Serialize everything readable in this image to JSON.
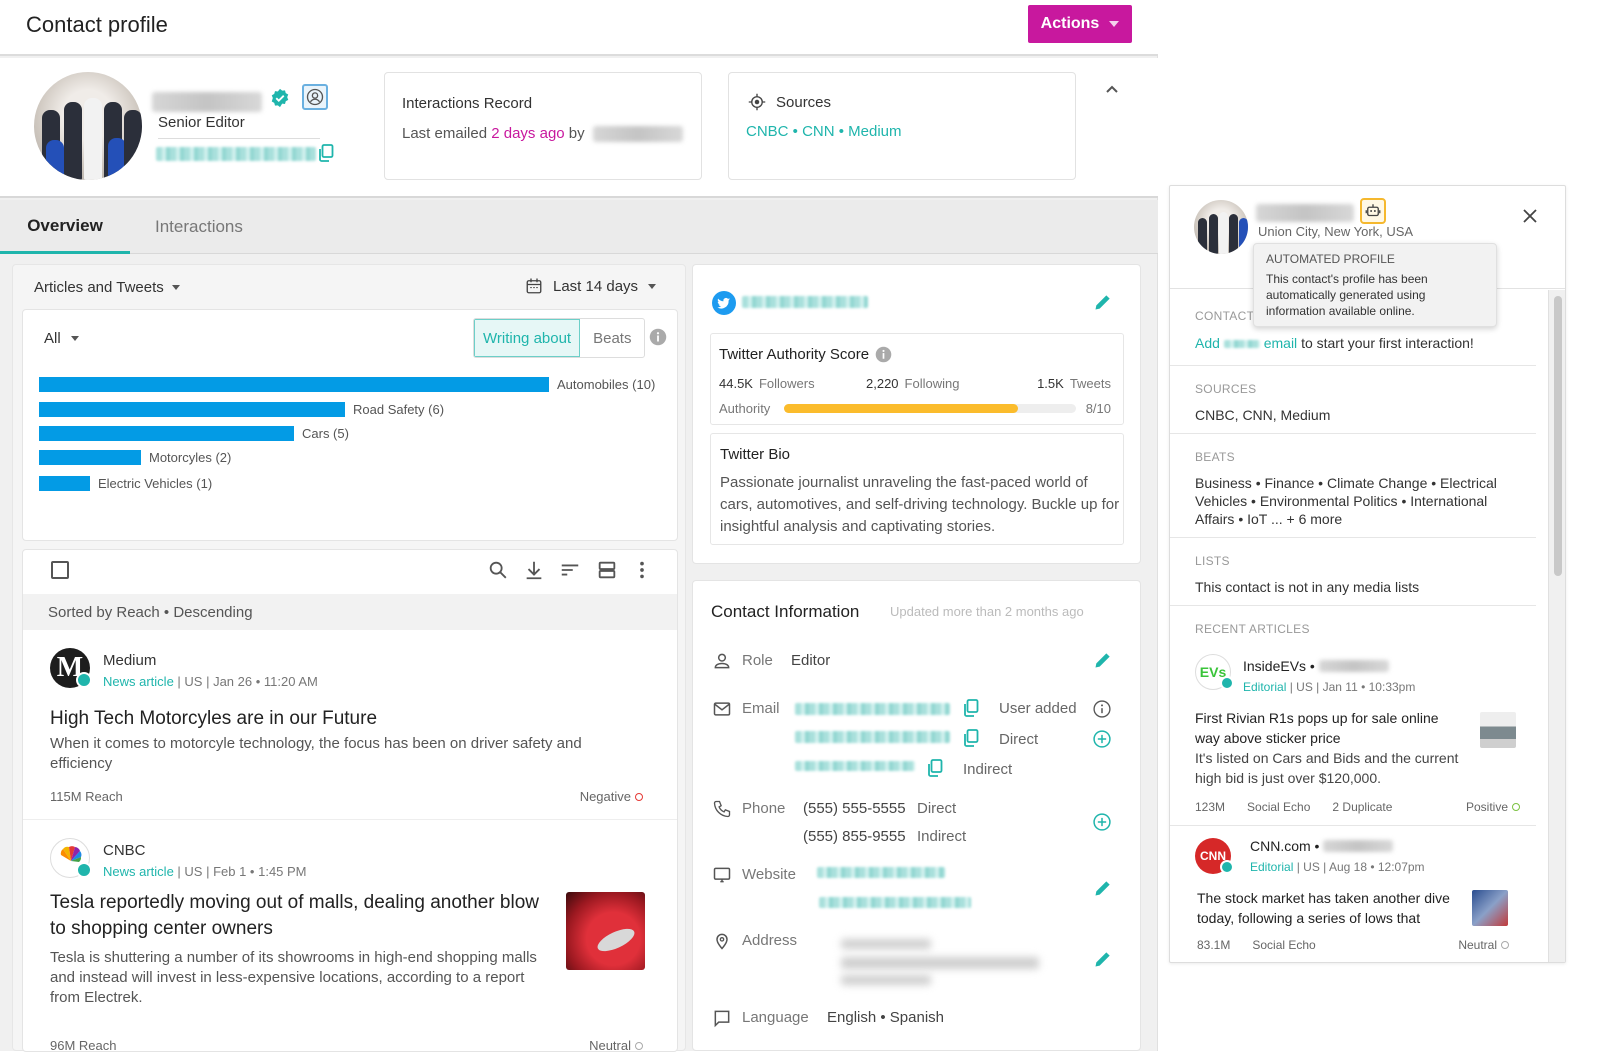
{
  "header": {
    "title": "Contact profile",
    "actions_label": "Actions"
  },
  "profile": {
    "title": "Senior Editor",
    "accent_color": "#1fb5ac",
    "brand_color": "#c8189e"
  },
  "interactions_record": {
    "title": "Interactions Record",
    "prefix": "Last emailed",
    "when": "2 days ago",
    "by": "by"
  },
  "sources_card": {
    "title": "Sources",
    "links": "CNBC • CNN • Medium"
  },
  "tabs": [
    {
      "label": "Overview",
      "active": true
    },
    {
      "label": "Interactions",
      "active": false
    }
  ],
  "articles_panel": {
    "filter_label": "Articles and Tweets",
    "date_range": "Last 14 days",
    "type_filter": "All",
    "toggle": {
      "writing_about": "Writing about",
      "beats": "Beats",
      "selected": "Writing about"
    },
    "sort_label": "Sorted by Reach • Descending"
  },
  "chart_data": {
    "type": "bar",
    "orientation": "horizontal",
    "title": "Writing about",
    "categories": [
      "Automobiles",
      "Road Safety",
      "Cars",
      "Motorcyles",
      "Electric Vehicles"
    ],
    "values": [
      10,
      6,
      5,
      2,
      1
    ],
    "labels": [
      "Automobiles (10)",
      "Road Safety (6)",
      "Cars (5)",
      "Motorcyles (2)",
      "Electric Vehicles (1)"
    ],
    "xlabel": "",
    "ylabel": "",
    "xlim": [
      0,
      10
    ],
    "grid": false,
    "color": "#039be5"
  },
  "articles": [
    {
      "source": "Medium",
      "type": "News article",
      "country": "US",
      "date": "Jan 26 • 11:20 AM",
      "title": "High Tech Motorcyles are in our Future",
      "body": "When it comes to motorcyle technology, the focus has been on driver safety and efficiency",
      "reach": "115M Reach",
      "sentiment": "Negative",
      "sentiment_color": "#e53935"
    },
    {
      "source": "CNBC",
      "type": "News article",
      "country": "US",
      "date": "Feb 1 • 1:45 PM",
      "title": "Tesla reportedly moving out of malls, dealing another blow to shopping center owners",
      "body": "Tesla is shuttering a number of its showrooms in high-end shopping malls and instead will invest in less-expensive locations, according to a report from Electrek.",
      "reach": "96M Reach",
      "sentiment": "Neutral",
      "sentiment_color": "#aaaaaa"
    }
  ],
  "twitter": {
    "handle_prefix": "@",
    "authority_title": "Twitter Authority Score",
    "followers_value": "44.5K",
    "followers_label": "Followers",
    "following_value": "2,220",
    "following_label": "Following",
    "tweets_value": "1.5K",
    "tweets_label": "Tweets",
    "authority_label": "Authority",
    "authority_score": 8,
    "authority_max": 10,
    "authority_text": "8/10",
    "bio_title": "Twitter Bio",
    "bio": "Passionate journalist unraveling the fast-paced world of cars, automotives, and self-driving technology. Buckle up for insightful analysis and captivating stories."
  },
  "contact_info": {
    "title": "Contact Information",
    "updated": "Updated more than 2 months ago",
    "role_label": "Role",
    "role_value": "Editor",
    "email_label": "Email",
    "emails": [
      {
        "tag": "User added"
      },
      {
        "tag": "Direct"
      },
      {
        "tag": "Indirect"
      }
    ],
    "phone_label": "Phone",
    "phones": [
      {
        "number": "(555) 555-5555",
        "tag": "Direct"
      },
      {
        "number": "(555) 855-9555",
        "tag": "Indirect"
      }
    ],
    "website_label": "Website",
    "address_label": "Address",
    "language_label": "Language",
    "language_value": "English • Spanish"
  },
  "side_panel": {
    "location": "Union City, New York, USA",
    "tooltip": {
      "title": "AUTOMATED PROFILE",
      "body": "This contact's profile has been automatically generated using information available online."
    },
    "contact_label": "CONTACT",
    "contact_add": "Add",
    "contact_email": "email",
    "contact_rest": "to start your first interaction!",
    "sources_label": "SOURCES",
    "sources_value": "CNBC, CNN, Medium",
    "beats_label": "BEATS",
    "beats_value": "Business • Finance • Climate Change • Electrical Vehicles • Environmental Politics • International Affairs  • IoT ... + 6 more",
    "lists_label": "LISTS",
    "lists_value": "This contact is not in any media lists",
    "recent_label": "RECENT ARTICLES",
    "recent_articles": [
      {
        "source": "InsideEVs •",
        "type": "Editorial",
        "country": "US",
        "date": "Jan 11 • 10:33pm",
        "title": "First Rivian R1s pops up for sale online way above sticker price",
        "body": "It's listed on Cars and Bids and the current high bid is just over $120,000.",
        "reach": "123M",
        "echo": "Social Echo",
        "duplicates": "2 Duplicate",
        "sentiment": "Positive",
        "sentiment_color": "#7cc242"
      },
      {
        "source": "CNN.com •",
        "type": "Editorial",
        "country": "US",
        "date": "Aug 18 • 12:07pm",
        "title": "",
        "body": "The stock market has taken another dive today, following a series of lows that",
        "reach": "83.1M",
        "echo": "Social Echo",
        "duplicates": "",
        "sentiment": "Neutral",
        "sentiment_color": "#aaaaaa"
      }
    ]
  }
}
